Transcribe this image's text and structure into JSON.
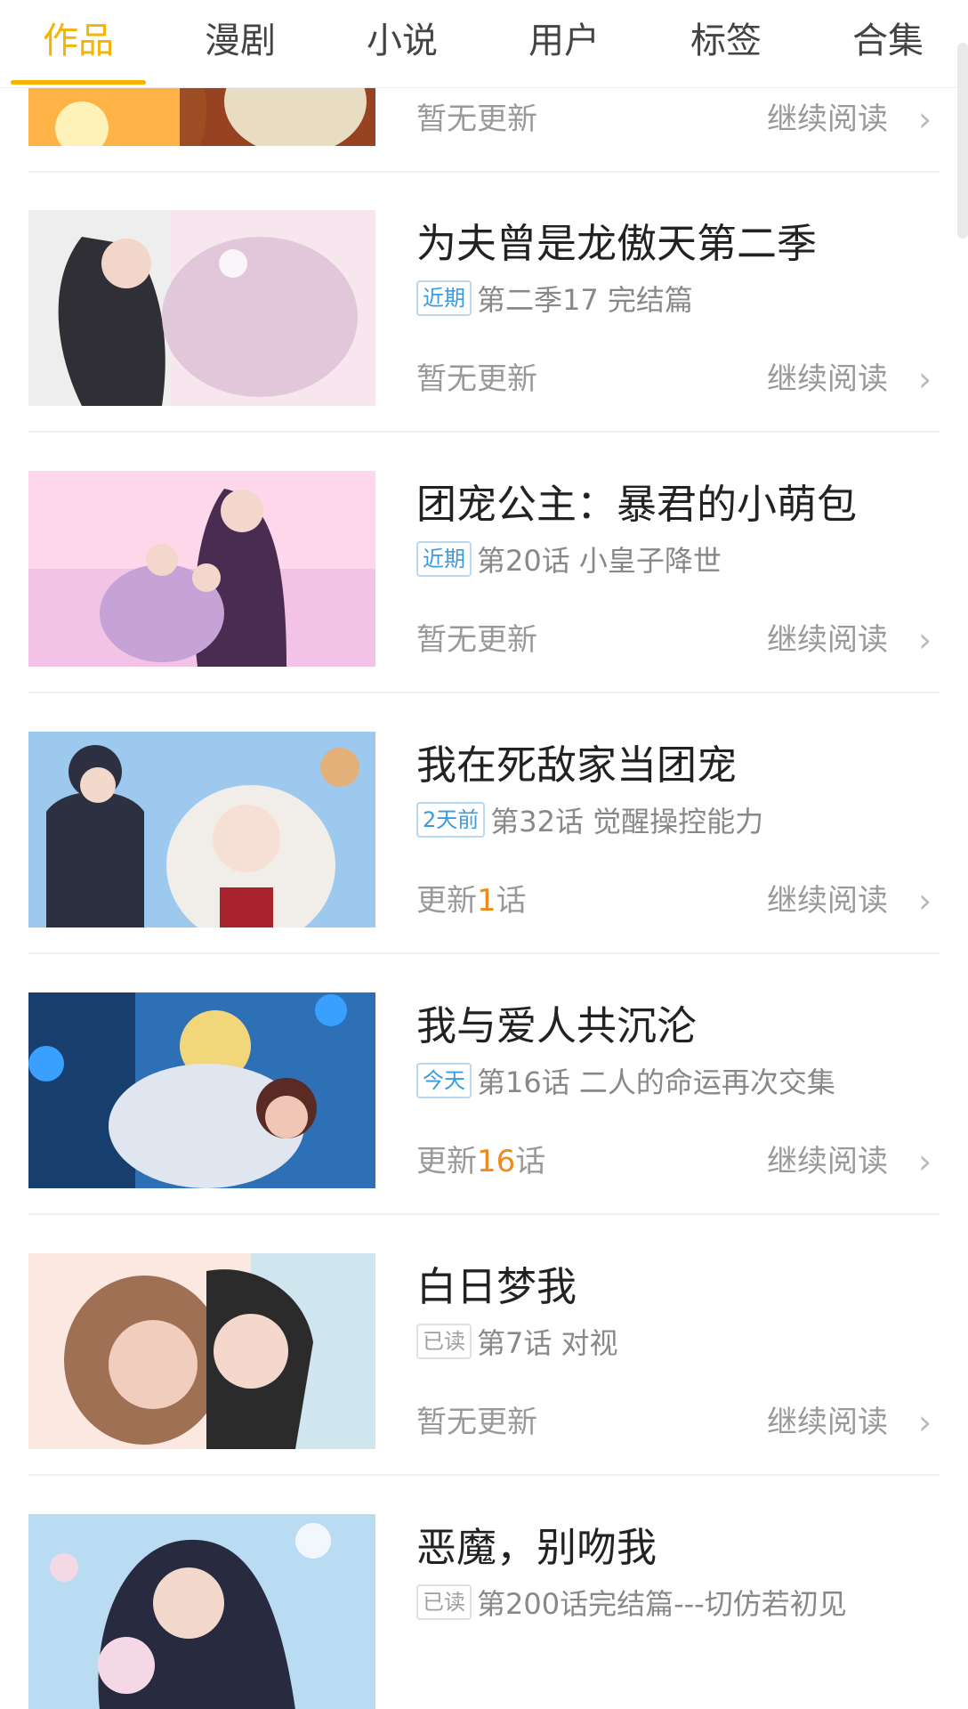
{
  "tabs": [
    "作品",
    "漫剧",
    "小说",
    "用户",
    "标签",
    "合集"
  ],
  "active_tab": "作品",
  "colors": {
    "accent": "#f5b400",
    "badge_blue": "#3a9be0",
    "update_orange": "#f08a1c",
    "text_dark": "#222222",
    "text_gray": "#999999"
  },
  "items": [
    {
      "title": "",
      "badge": "",
      "episode": "",
      "update_prefix": "暂无更新",
      "update_count": "",
      "update_suffix": "",
      "continue_label": "继续阅读",
      "chevron": "›",
      "cover_palette": [
        "#ffb347",
        "#8c3b1f",
        "#e8dcc3",
        "#d56a2f"
      ]
    },
    {
      "title": "为夫曾是龙傲天第二季",
      "badge": "近期",
      "episode": "第二季17 完结篇",
      "update_prefix": "暂无更新",
      "update_count": "",
      "update_suffix": "",
      "continue_label": "继续阅读",
      "chevron": "›",
      "cover_palette": [
        "#f7e6ee",
        "#2f2f35",
        "#dcbfd4",
        "#eeeeee"
      ]
    },
    {
      "title": "团宠公主：暴君的小萌包",
      "badge": "近期",
      "episode": "第20话 小皇子降世",
      "update_prefix": "暂无更新",
      "update_count": "",
      "update_suffix": "",
      "continue_label": "继续阅读",
      "chevron": "›",
      "cover_palette": [
        "#f3c3e5",
        "#4a2c52",
        "#c6a2d6",
        "#ffd7ea"
      ]
    },
    {
      "title": "我在死敌家当团宠",
      "badge": "2天前",
      "episode": "第32话 觉醒操控能力",
      "update_prefix": "更新",
      "update_count": "1",
      "update_suffix": "话",
      "continue_label": "继续阅读",
      "chevron": "›",
      "cover_palette": [
        "#9dc9ef",
        "#2c3040",
        "#f1ede8",
        "#e4b079"
      ]
    },
    {
      "title": "我与爱人共沉沦",
      "badge": "今天",
      "episode": "第16话 二人的命运再次交集",
      "update_prefix": "更新",
      "update_count": "16",
      "update_suffix": "话",
      "continue_label": "继续阅读",
      "chevron": "›",
      "cover_palette": [
        "#2e70b6",
        "#0f2a50",
        "#f1d77a",
        "#f0c6b6"
      ]
    },
    {
      "title": "白日梦我",
      "badge": "已读",
      "episode": "第7话 对视",
      "update_prefix": "暂无更新",
      "update_count": "",
      "update_suffix": "",
      "continue_label": "继续阅读",
      "chevron": "›",
      "cover_palette": [
        "#fbe8e1",
        "#2b2b2b",
        "#cfe6ef",
        "#f0cdbd"
      ]
    },
    {
      "title": "恶魔，别吻我",
      "badge": "已读",
      "episode": "第200话完结篇---切仿若初见",
      "update_prefix": "",
      "update_count": "",
      "update_suffix": "",
      "continue_label": "",
      "chevron": "",
      "cover_palette": [
        "#b9dcf2",
        "#282a40",
        "#f5d8e6",
        "#ffffff"
      ]
    }
  ]
}
